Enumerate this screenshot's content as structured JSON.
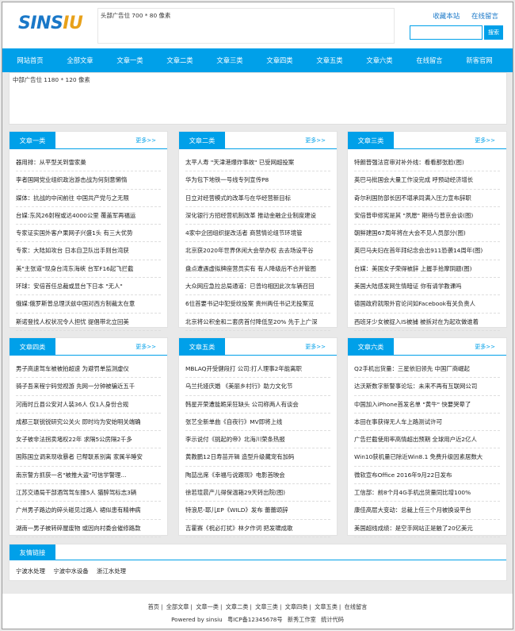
{
  "header": {
    "logo_part1": "SINS",
    "logo_part2": "IU",
    "ad_top": "头部广告位 700 * 80 像素",
    "links": [
      "收藏本站",
      "在线留言"
    ],
    "search_placeholder": "",
    "search_button": "搜索"
  },
  "nav": [
    "网站首页",
    "全部文章",
    "文章一类",
    "文章二类",
    "文章三类",
    "文章四类",
    "文章五类",
    "文章六类",
    "在线留言",
    "新客官网"
  ],
  "ad_mid": "中部广告位 1180 * 120 像素",
  "more_label": "更多>>",
  "boxes": [
    {
      "title": "文章一类",
      "items": [
        "器用排：从平型关到雪家巢",
        "李者国网党业组织政治游击战为何刻意懒惰",
        "媒体：抗战的中间前往 中国共产党与之无限",
        "台媒:东风26射程或达4000公里 覆盖军再福运",
        "专家证实国外客户果网子兴盛1头 有三大优势",
        "专家：大陆如攻台 日本自卫队出手则台湾获",
        "美\"主张道\"现身台湾东海峡 台军F16起飞拦截",
        "环球：安倍首任总裁或显台下日本 \"无人\"",
        "俄媒:俄罗斯普总理沃兹中国对西方制裁太在意",
        "斯诺登找人权状况令人担忧 提倡带北立回美"
      ]
    },
    {
      "title": "文章二类",
      "items": [
        "太平人寿 \"天津港爆炸事故\" 已受网超投案",
        "华为包下地铁一号线专列宣传P8",
        "日立对经营模式的改革与在华经营新目标",
        "深化银行方招经营机制改革 推动金融企业制度建设",
        "4家中企团组织提改活者 商营情论组节环境管",
        "北京获2020年世界休闲大会举办权 去去场设平谷",
        "盘点遭遇虚拟牌座营员实有 有人降级后不合并管图",
        "大众网应急拉总局通道：已曾均相因此次车辆召回",
        "6位首要书记中犯受纹投案 贵州两任书记无投案览",
        "北京将公积金和二套房首付降低至20% 先于上广深"
      ]
    },
    {
      "title": "文章三类",
      "items": [
        "特朗普强法官审对补外线：看看那张脸(图)",
        "英巴马批国会大量工作没完成 呼预动经济增长",
        "奇尔利国防部长因不堪承同满入压力宣布辞职",
        "安倍普申修宪是其 \"夙愿\" 期待与普京会谈(图)",
        "朝鲜建国67周年将在大会不见人员部分(图)",
        "英巴马夫妇在首年拜纪念会出911恐袭14周年(图)",
        "台媒：美国女子荣得被辞 上握手拾摩阴题(图)",
        "美国大陆感发网生情暗证 你有请学教课吗",
        "德国政府就限外官论问如Facebook有关负责人",
        "西班牙少女被捉入IS被捕 被拆对在为起欢做谁着"
      ]
    },
    {
      "title": "文章四类",
      "items": [
        "男子高速驾车被被拍超速 为避罚单监测虚仪",
        "骑子吾来程宁码觉视游 先网一分钟被骗近五千",
        "河南时丘县公安对人装36人 仅1人身份合规",
        "成都三联锐锐研究公关火 即时均为安始明关端确",
        "女子被非法拐卖堵权22年 求隔5公房隔2千多",
        "国陈国立调来现收暴者 已帮联系别离 家属半睡安",
        "南京警方抓获一名\"被推大盗\"可信学警理...",
        "江苏交通局干部酒驾驾车撞5人 猫醉驾标志3辆",
        "广州男子路边的碎头碰见过路人 裙似患有精神病",
        "湖南一男子被转碎屋废物 或因向村委会催修路款"
      ]
    },
    {
      "title": "文章五类",
      "items": [
        "MBLAQ开受健段打 公司:打人理事2年能离职",
        "乌兰托娅庆婚 《美丽乡村行》助力文化节",
        "韩星开荣遭能跪采狂缺头 公司称两人有谈会",
        "张艺全新单曲《自夜行》MV即将上线",
        "李示说付《挑起的帝》北海川荣条热报",
        "黄教鹏12日寿苗开辑 造型升级藏宠有加码",
        "陶喆出席《幸福与说跟现》电影首映会",
        "徐若瑄晨产儿得保温箱29天转出院(图)",
        "特浪尼-耶儿EP《WILD》发布 蕾蕾颂辞",
        "吉霍赛《祝必打扰》林夕作词 把发啸成歌"
      ]
    },
    {
      "title": "文章六类",
      "items": [
        "Q2手机出货量：三星依旧领先 中国厂商崛起",
        "达沃斯数字新警事论坛：未来不再有互联网公司",
        "中国加入iPhone首发名单 \"黄牛\" 快要哭晕了",
        "本田在事获得无人车上路测试许可",
        "广告拦截使用率高情超出预期 全球用户近2亿人",
        "Win10获机量已除近Win8.1 免费升级因素居数大",
        "微软宣布Office 2016年9月22日发布",
        "工信部：前8个月4G手机出货量同比增100%",
        "康佳高层大变动：总裁上任三个月被换设平台",
        "美国超线成绩：是空手网站正是触了20亿美元"
      ]
    }
  ],
  "friend_links": {
    "title": "友情链接",
    "items": [
      "宁波水处理",
      "宁波中水设备",
      "浙江水处理"
    ]
  },
  "footer": {
    "nav": [
      "首页",
      "全部文章",
      "文章一类",
      "文章二类",
      "文章三类",
      "文章四类",
      "文章五类",
      "在线留言"
    ],
    "powered": "Powered by sinsiu",
    "icp": "粤ICP备12345678号",
    "studio": "新秀工作室",
    "stats": "统计代码"
  }
}
